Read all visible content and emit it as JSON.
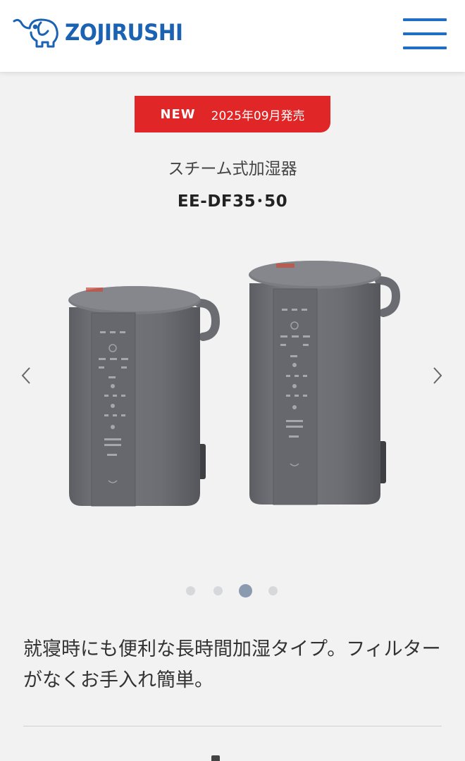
{
  "header": {
    "brand": "ZOJIRUSHI",
    "logo_icon": "elephant-icon",
    "menu_icon": "hamburger-menu-icon"
  },
  "badge": {
    "label": "NEW",
    "release": "2025年09月発売",
    "color": "#e02626"
  },
  "product": {
    "category": "スチーム式加湿器",
    "model": "EE-DF35･50",
    "images": [
      "humidifier-ee-df35",
      "humidifier-ee-df50"
    ]
  },
  "carousel": {
    "prev_icon": "chevron-left-icon",
    "next_icon": "chevron-right-icon",
    "slide_count": 4,
    "active_index": 3
  },
  "description": "就寝時にも便利な長時間加湿タイプ。フィルターがなくお手入れ簡単。",
  "colors": {
    "brand_blue": "#1b62b3",
    "menu_blue": "#1f6ec3",
    "product_gray": "#6b6d73"
  }
}
